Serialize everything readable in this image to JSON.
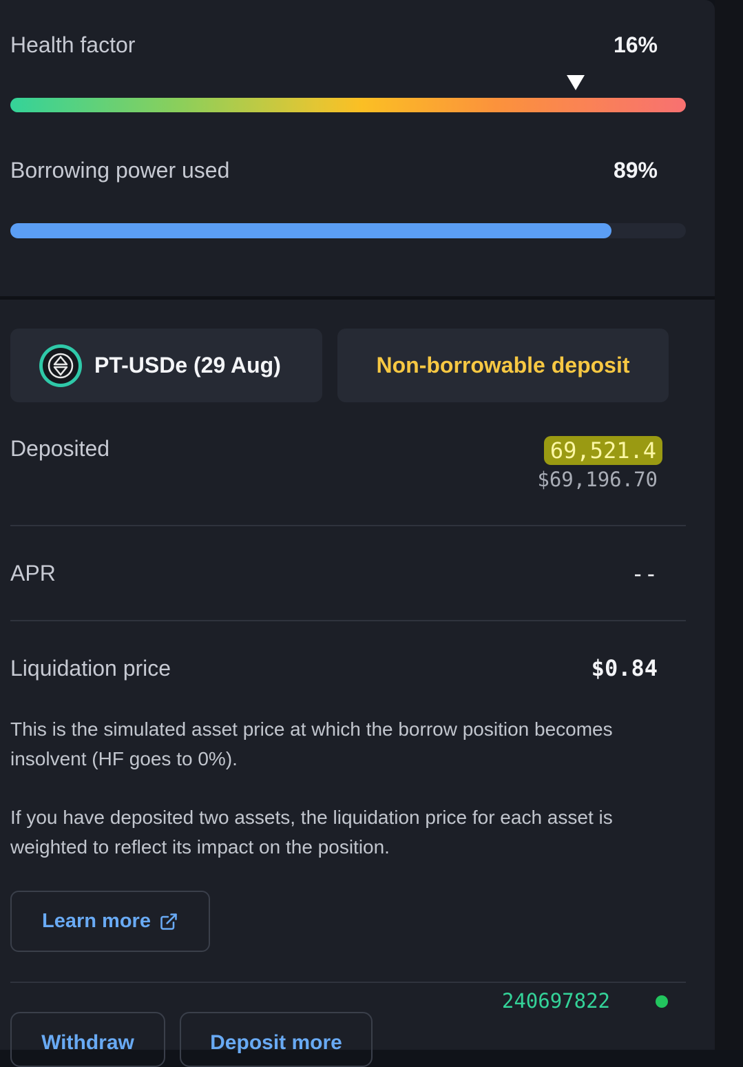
{
  "health_factor": {
    "label": "Health factor",
    "value": "16%"
  },
  "borrowing_power": {
    "label": "Borrowing power used",
    "value": "89%",
    "fill_percent": 89
  },
  "asset_chip": {
    "name": "PT-USDe (29 Aug)",
    "icon": "usde-token-icon"
  },
  "status_chip": {
    "label": "Non-borrowable deposit"
  },
  "deposited": {
    "label": "Deposited",
    "amount": "69,521.4",
    "usd_value": "$69,196.70"
  },
  "apr": {
    "label": "APR",
    "value": "--"
  },
  "liquidation": {
    "label": "Liquidation price",
    "value": "$0.84",
    "description_1": "This is the simulated asset price at which the borrow position becomes insolvent (HF goes to 0%).",
    "description_2": "If you have deposited two assets, the liquidation price for each asset is weighted to reflect its impact on the position."
  },
  "learn_more": {
    "label": "Learn more"
  },
  "footer": {
    "block_number": "240697822",
    "withdraw_label": "Withdraw",
    "deposit_more_label": "Deposit more"
  },
  "colors": {
    "accent_blue": "#5b9ef4",
    "warning_yellow": "#f7c843",
    "success_green": "#34d399"
  }
}
